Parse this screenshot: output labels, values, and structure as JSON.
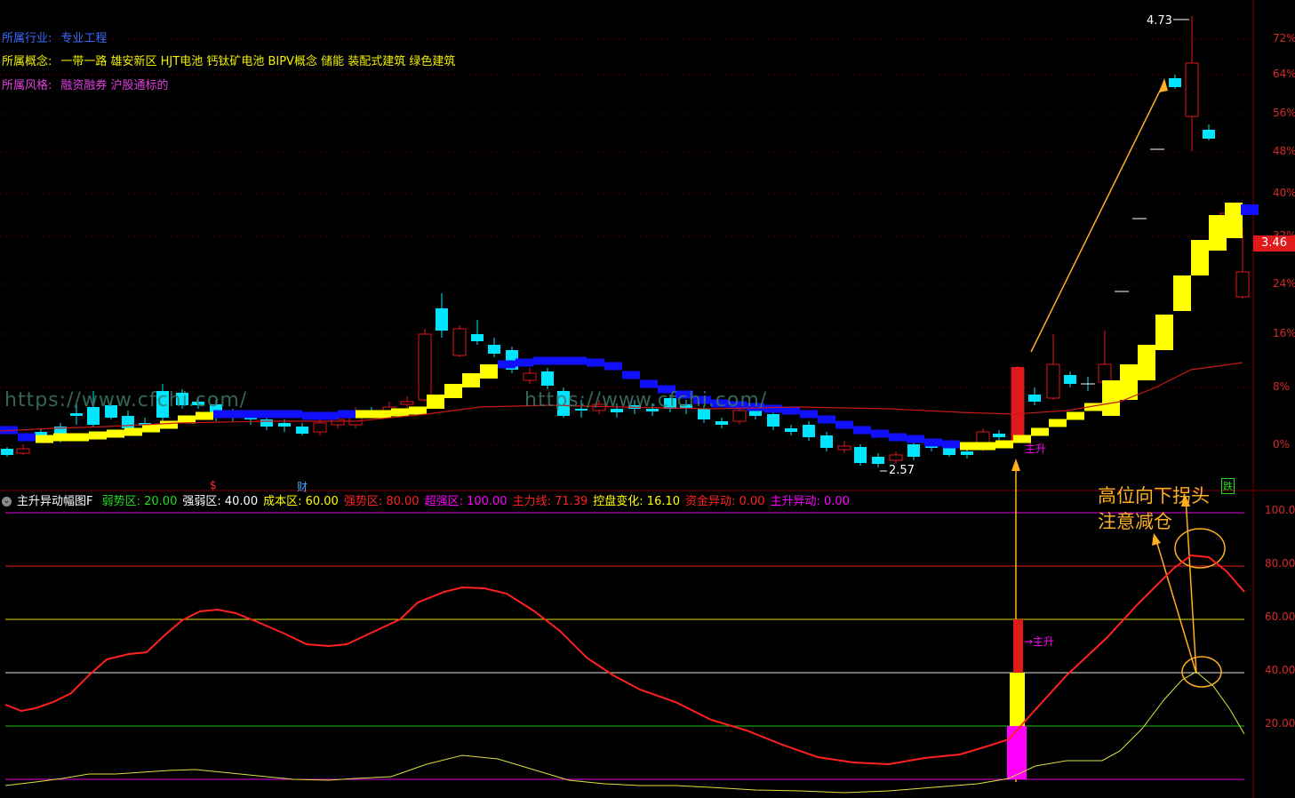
{
  "info": {
    "industry_label": "所属行业:",
    "industry_value": "专业工程",
    "concept_label": "所属概念:",
    "concept_value": "一带一路 雄安新区 HJT电池 钙钛矿电池 BIPV概念 储能 装配式建筑 绿色建筑",
    "style_label": "所属风格:",
    "style_value": "融资融券 沪股通标的"
  },
  "price_axis": [
    "72%",
    "64%",
    "56%",
    "48%",
    "40%",
    "32%",
    "24%",
    "16%",
    "8%",
    "0%"
  ],
  "indicator_axis": [
    "100.00",
    "80.00",
    "60.00",
    "40.00",
    "20.00"
  ],
  "current_price": "3.46",
  "high_label": "4.73",
  "low_label": "2.57",
  "indicator": {
    "name": "主升异动幅图F",
    "params": [
      {
        "label": "弱势区:",
        "value": "20.00",
        "color": "#22dd22"
      },
      {
        "label": "强弱区:",
        "value": "40.00",
        "color": "#ffffff"
      },
      {
        "label": "成本区:",
        "value": "60.00",
        "color": "#ffff00"
      },
      {
        "label": "强势区:",
        "value": "80.00",
        "color": "#ff2222"
      },
      {
        "label": "超强区:",
        "value": "100.00",
        "color": "#ff00ff"
      },
      {
        "label": "主力线:",
        "value": "71.39",
        "color": "#ff2222"
      },
      {
        "label": "控盘变化:",
        "value": "16.10",
        "color": "#ffff00"
      },
      {
        "label": "资金异动:",
        "value": "0.00",
        "color": "#ff2222"
      },
      {
        "label": "主升异动:",
        "value": "0.00",
        "color": "#ff00ff"
      }
    ]
  },
  "watermark": "https://www.cfchi.com/",
  "signal_label": "主升",
  "signal_label_lower": "→主升",
  "annotation": {
    "line1": "高位向下拐头",
    "line2": "注意减仓"
  },
  "markers": {
    "cai": "财",
    "die": "跌",
    "dollar": "$"
  },
  "colors": {
    "up": "#e0191a",
    "down": "#00e5ff",
    "yellow_band": "#ffff00",
    "blue_band": "#1010ff",
    "magenta": "#ff00ff",
    "orange": "#ffb020"
  }
}
